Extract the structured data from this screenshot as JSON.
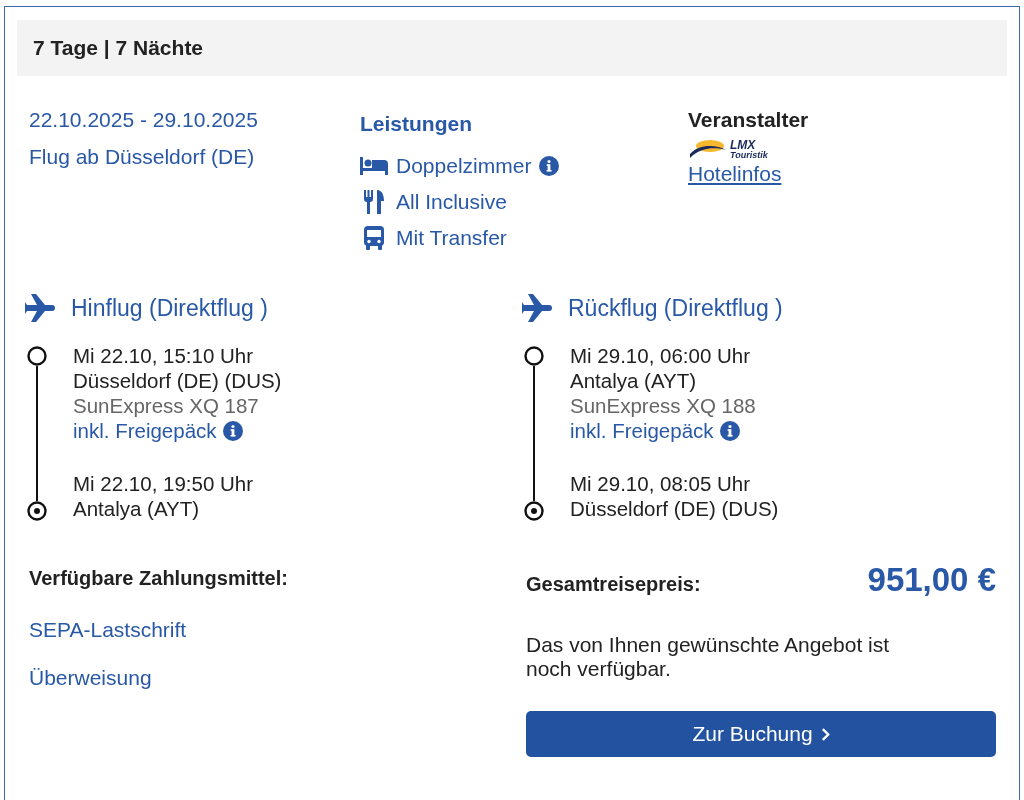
{
  "header": {
    "title": "7 Tage | 7 Nächte"
  },
  "trip": {
    "dates": "22.10.2025 - 29.10.2025",
    "departure": "Flug ab Düsseldorf (DE)"
  },
  "services": {
    "title": "Leistungen",
    "items": [
      {
        "kind": "room",
        "label": "Doppelzimmer",
        "info": true
      },
      {
        "kind": "meals",
        "label": "All Inclusive",
        "info": false
      },
      {
        "kind": "transfer",
        "label": "Mit Transfer",
        "info": false
      }
    ]
  },
  "operator": {
    "title": "Veranstalter",
    "logo_name": "LMX",
    "logo_sub": "Touristik",
    "link": "Hotelinfos"
  },
  "flights": [
    {
      "title": "Hinflug (Direktflug )",
      "stops": [
        {
          "kind": "departure",
          "time": "Mi 22.10, 15:10 Uhr",
          "place": "Düsseldorf (DE) (DUS)",
          "airline": "SunExpress XQ 187",
          "baggage": "inkl. Freigepäck"
        },
        {
          "kind": "arrival",
          "time": "Mi 22.10, 19:50 Uhr",
          "place": "Antalya (AYT)"
        }
      ]
    },
    {
      "title": "Rückflug (Direktflug )",
      "stops": [
        {
          "kind": "departure",
          "time": "Mi 29.10, 06:00 Uhr",
          "place": "Antalya (AYT)",
          "airline": "SunExpress XQ 188",
          "baggage": "inkl. Freigepäck"
        },
        {
          "kind": "arrival",
          "time": "Mi 29.10, 08:05 Uhr",
          "place": "Düsseldorf (DE) (DUS)"
        }
      ]
    }
  ],
  "payment": {
    "title": "Verfügbare Zahlungsmittel:",
    "methods": [
      "SEPA-Lastschrift",
      "Überweisung"
    ]
  },
  "price": {
    "label": "Gesamtreisepreis:",
    "amount": "951,00 €",
    "note": "Das von Ihnen gewünschte Angebot ist noch verfügbar.",
    "button": "Zur Buchung"
  }
}
